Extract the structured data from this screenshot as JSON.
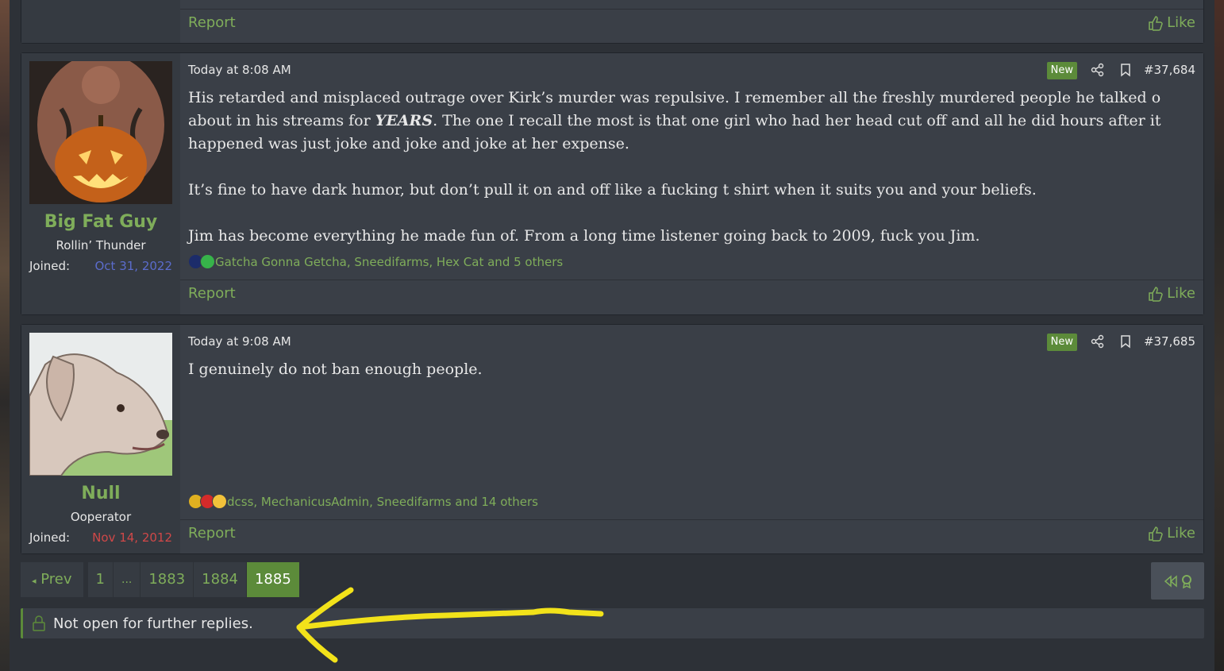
{
  "top_post_footer": {
    "report": "Report",
    "like": "Like"
  },
  "posts": [
    {
      "username": "Big Fat Guy",
      "user_title": "Rollin’ Thunder",
      "joined_label": "Joined:",
      "joined_date": "Oct 31, 2022",
      "joined_color": "#5b6ccc",
      "time": "Today at 8:08 AM",
      "badge": "New",
      "number": "#37,684",
      "paragraphs": [
        {
          "before": "His retarded and misplaced outrage over Kirk’s murder was repulsive. I remember all the freshly murdered people he talked o about in his streams for ",
          "emphasis": "YEARS",
          "after": ". The one I recall the most is that one girl who had her head cut off and all he did hours after it happened was just joke and joke and joke at her expense."
        },
        {
          "before": "It’s fine to have dark humor, but don’t pull it on and off like a fucking t shirt when it suits you and your beliefs.",
          "emphasis": "",
          "after": ""
        },
        {
          "before": "Jim has become everything he made fun of. From a long time listener going back to 2009, fuck you Jim.",
          "emphasis": "",
          "after": ""
        }
      ],
      "reactions": "Gatcha Gonna Getcha, Sneedifarms, Hex Cat and 5 others",
      "report": "Report",
      "like": "Like"
    },
    {
      "username": "Null",
      "user_title": "Ooperator",
      "joined_label": "Joined:",
      "joined_date": "Nov 14, 2012",
      "joined_color": "#d04848",
      "time": "Today at 9:08 AM",
      "badge": "New",
      "number": "#37,685",
      "paragraphs": [
        {
          "before": "I genuinely do not ban enough people.",
          "emphasis": "",
          "after": ""
        }
      ],
      "reactions": "dcss, MechanicusAdmin, Sneedifarms and 14 others",
      "report": "Report",
      "like": "Like"
    }
  ],
  "pagination": {
    "prev": "Prev",
    "pages": [
      "1",
      "...",
      "1883",
      "1884",
      "1885"
    ],
    "current": "1885"
  },
  "locked_notice": "Not open for further replies.",
  "colors": {
    "accent": "#7fad5a",
    "badge": "#5c8b3a",
    "annotation": "#f2e21a"
  },
  "icons": [
    "thumbs-up-icon",
    "share-icon",
    "bookmark-icon",
    "lock-icon",
    "chevron-left-icon",
    "jump-unread-icon"
  ]
}
